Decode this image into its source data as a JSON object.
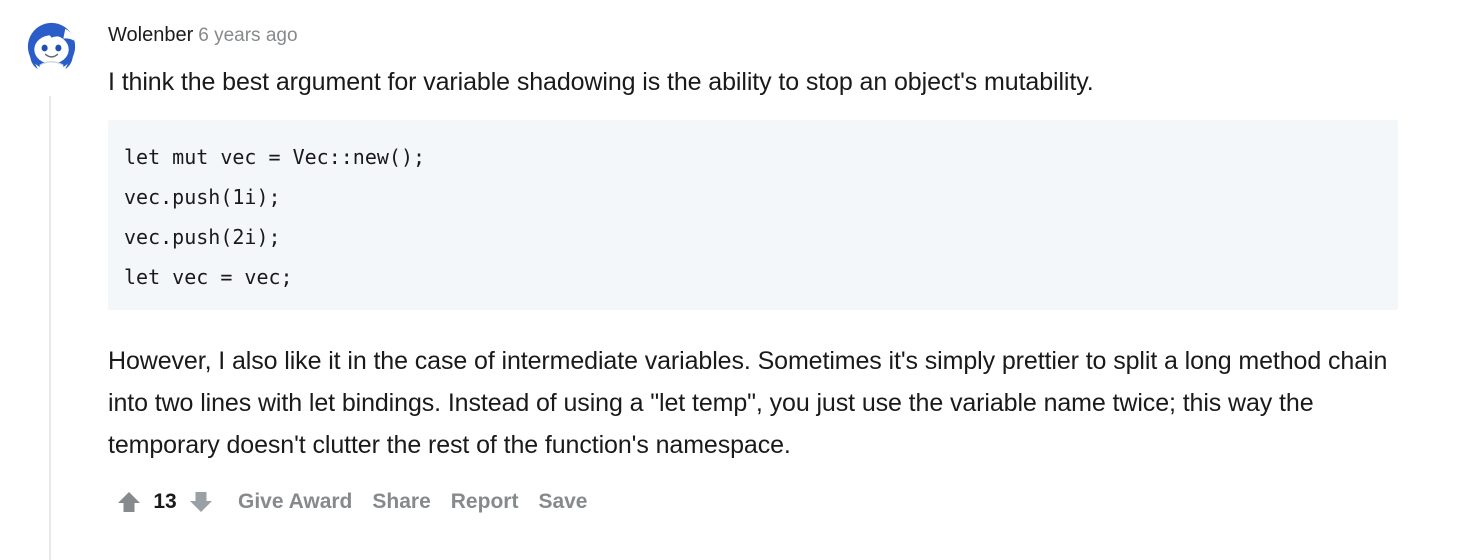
{
  "comment": {
    "author": "Wolenber",
    "timestamp": "6 years ago",
    "avatar_icon": "reddit-snoo-avatar-icon",
    "paragraph_1": "I think the best argument for variable shadowing is the ability to stop an object's mutability.",
    "code_block": "let mut vec = Vec::new();\nvec.push(1i);\nvec.push(2i);\nlet vec = vec;",
    "paragraph_2": "However, I also like it in the case of intermediate variables. Sometimes it's simply prettier to split a long method chain into two lines with let bindings. Instead of using a \"let temp\", you just use the variable name twice; this way the temporary doesn't clutter the rest of the function's namespace."
  },
  "actions": {
    "upvote_icon": "upvote-arrow-icon",
    "downvote_icon": "downvote-arrow-icon",
    "score": "13",
    "give_award_label": "Give Award",
    "share_label": "Share",
    "report_label": "Report",
    "save_label": "Save"
  },
  "colors": {
    "text": "#1a1a1b",
    "muted": "#878a8c",
    "code_background": "#f4f7f9",
    "thread_line": "#e6e8ea",
    "avatar_blue": "#2a5dc8",
    "page_background": "#ffffff"
  }
}
